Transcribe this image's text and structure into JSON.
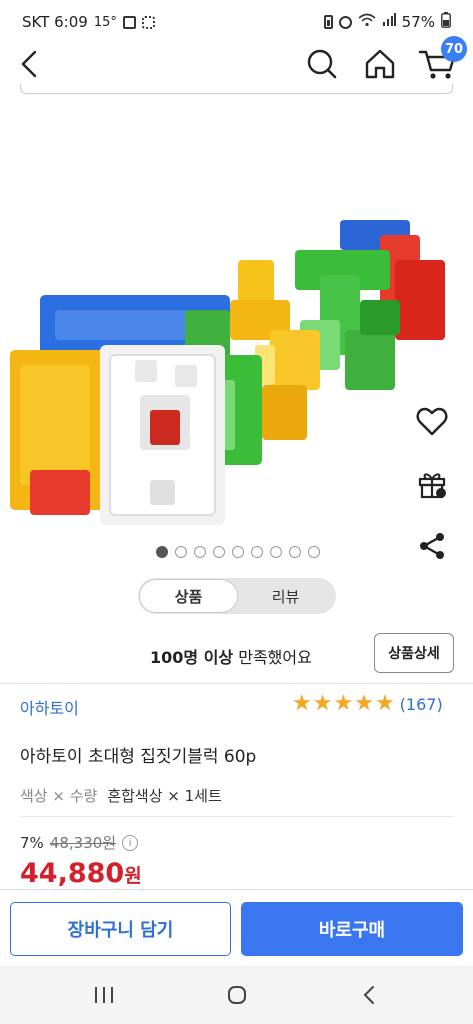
{
  "status_bar": {
    "carrier_time": "SKT 6:09",
    "temp": "15°",
    "battery": "57%"
  },
  "header": {
    "cart_count": "70",
    "icons": [
      "back-icon",
      "search-icon",
      "home-icon",
      "cart-icon"
    ]
  },
  "gallery": {
    "image_alt": "toy-blocks-image",
    "total_slides": 9,
    "active_slide": 1,
    "side_icons": [
      "heart-icon",
      "gift-icon",
      "share-icon"
    ]
  },
  "tabs": [
    {
      "label": "상품",
      "active": true
    },
    {
      "label": "리뷰",
      "active": false
    }
  ],
  "satisfaction": {
    "count": "100명 이상",
    "text": " 만족했어요",
    "detail_button": "상품상세"
  },
  "product": {
    "brand": "아하토이",
    "rating_stars": 5,
    "review_count": "(167)",
    "title": "아하토이 초대형 집짓기블럭 60p",
    "option_label": "색상 × 수량",
    "option_value": "혼합색상 × 1세트",
    "discount": "7%",
    "original_price": "48,330원",
    "sale_price": "44,880",
    "currency": "원"
  },
  "actions": {
    "add_to_cart": "장바구니 담기",
    "buy_now": "바로구매"
  },
  "colors": {
    "accent": "#3a76f0",
    "price_red": "#d3202a",
    "star": "#f5a623"
  }
}
